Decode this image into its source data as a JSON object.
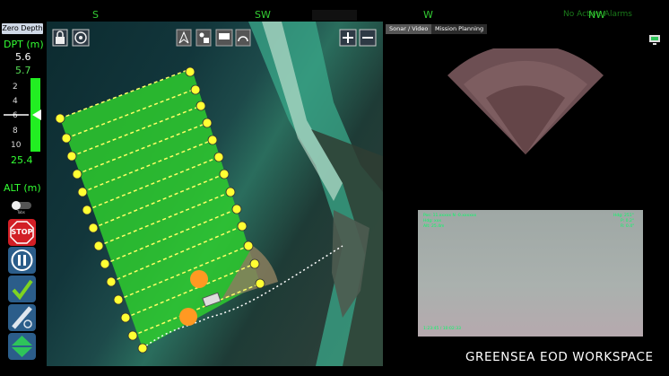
{
  "compass": {
    "ticks": [
      "S",
      "SW",
      "W",
      "NW"
    ],
    "alarms": "No Active Alarms"
  },
  "left": {
    "zero_depth": "Zero Depth",
    "dpt_label": "DPT (m)",
    "depth_value": "5.6",
    "target_depth": "5.7",
    "scale": [
      "2",
      "4",
      "6",
      "8",
      "10"
    ],
    "max_depth": "25.4",
    "alt_label": "ALT (m)",
    "tabs_label": "Tabs",
    "stop": "STOP"
  },
  "right": {
    "tabs": [
      "Sonar / Video",
      "Mission Planning"
    ],
    "video_overlay": {
      "top_left": [
        "Pos: 11.xxxxx N  -0.xxxxxx",
        "Hdg: xxx",
        "Alt: 25.4m"
      ],
      "top_right": [
        "Hdg: 251°",
        "P: 0.2°",
        "R: 0.4°"
      ],
      "bottom_left": "1:23:45 / 10:02:33"
    },
    "brand": "GREENSEA EOD WORKSPACE"
  },
  "colors": {
    "accent": "#33ff33",
    "survey_fill": "#2ecc2e",
    "waypoint": "#ffff33",
    "stop": "#d21f26",
    "check": "#7ed321"
  }
}
